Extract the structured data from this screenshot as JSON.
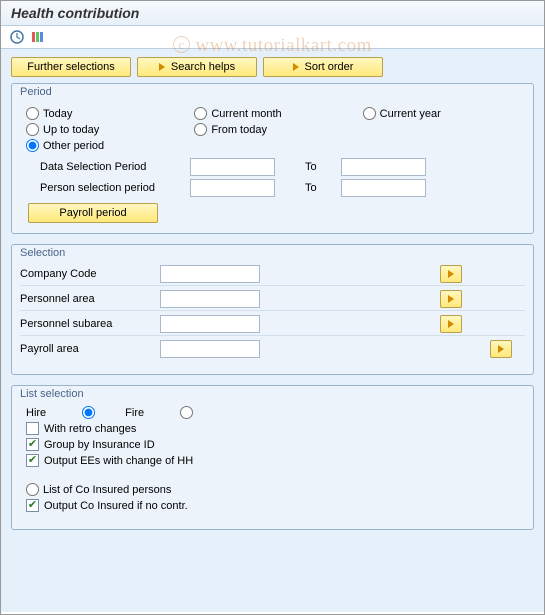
{
  "header": {
    "title": "Health contribution"
  },
  "toolbar_buttons": {
    "further_selections": "Further selections",
    "search_helps": "Search helps",
    "sort_order": "Sort order"
  },
  "period": {
    "panel_title": "Period",
    "radios": {
      "today": "Today",
      "current_month": "Current month",
      "current_year": "Current year",
      "up_to_today": "Up to today",
      "from_today": "From today",
      "other_period": "Other period"
    },
    "fields": {
      "data_selection_period": "Data Selection Period",
      "person_selection_period": "Person selection period",
      "to": "To"
    },
    "payroll_period_btn": "Payroll period"
  },
  "selection": {
    "panel_title": "Selection",
    "rows": {
      "company_code": "Company Code",
      "personnel_area": "Personnel area",
      "personnel_subarea": "Personnel subarea",
      "payroll_area": "Payroll area"
    }
  },
  "list_selection": {
    "panel_title": "List selection",
    "hire": "Hire",
    "fire": "Fire",
    "with_retro_changes": "With retro changes",
    "group_by_insurance_id": "Group by Insurance ID",
    "output_ees_change_hh": "Output EEs with change of HH",
    "list_co_insured": "List of Co Insured persons",
    "output_co_insured_no_contr": "Output Co Insured if no contr."
  },
  "watermark": "www.tutorialkart.com"
}
